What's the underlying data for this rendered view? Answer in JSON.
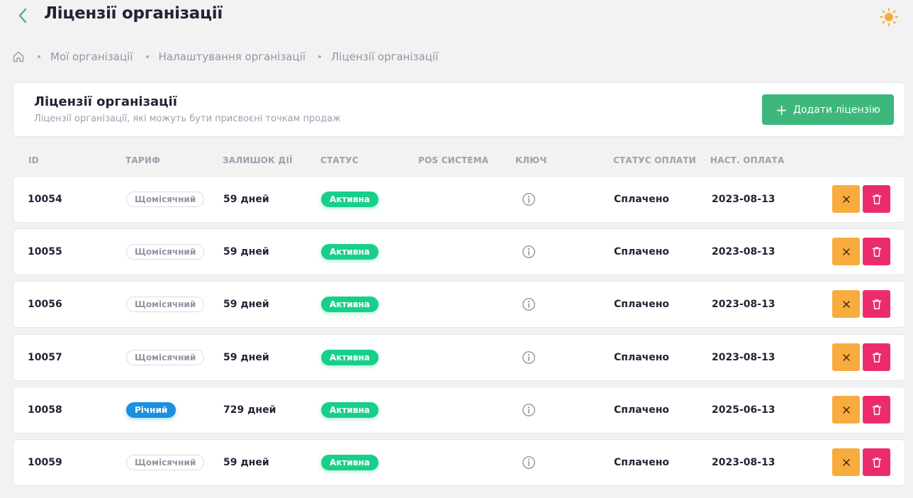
{
  "header": {
    "title": "Ліцензії організації"
  },
  "breadcrumb": {
    "items": [
      "Мої організації",
      "Налаштування організації",
      "Ліцензії організації"
    ]
  },
  "card": {
    "title": "Ліцензії організації",
    "subtitle": "Ліцензії організації, які можуть бути присвоєні точкам продаж",
    "add_button_label": "Додати ліцензію"
  },
  "table": {
    "columns": [
      "ID",
      "ТАРИФ",
      "ЗАЛИШОК ДІЇ",
      "СТАТУС",
      "POS СИСТЕМА",
      "КЛЮЧ",
      "СТАТУС ОПЛАТИ",
      "НАСТ. ОПЛАТА"
    ],
    "rows": [
      {
        "id": "10054",
        "tariff": "Щомісячний",
        "tariff_type": "monthly",
        "remaining": "59 дней",
        "status": "Активна",
        "pos": "",
        "payment_status": "Сплачено",
        "next_payment": "2023-08-13"
      },
      {
        "id": "10055",
        "tariff": "Щомісячний",
        "tariff_type": "monthly",
        "remaining": "59 дней",
        "status": "Активна",
        "pos": "",
        "payment_status": "Сплачено",
        "next_payment": "2023-08-13"
      },
      {
        "id": "10056",
        "tariff": "Щомісячний",
        "tariff_type": "monthly",
        "remaining": "59 дней",
        "status": "Активна",
        "pos": "",
        "payment_status": "Сплачено",
        "next_payment": "2023-08-13"
      },
      {
        "id": "10057",
        "tariff": "Щомісячний",
        "tariff_type": "monthly",
        "remaining": "59 дней",
        "status": "Активна",
        "pos": "",
        "payment_status": "Сплачено",
        "next_payment": "2023-08-13"
      },
      {
        "id": "10058",
        "tariff": "Річний",
        "tariff_type": "yearly",
        "remaining": "729 дней",
        "status": "Активна",
        "pos": "",
        "payment_status": "Сплачено",
        "next_payment": "2025-06-13"
      },
      {
        "id": "10059",
        "tariff": "Щомісячний",
        "tariff_type": "monthly",
        "remaining": "59 дней",
        "status": "Активна",
        "pos": "",
        "payment_status": "Сплачено",
        "next_payment": "2023-08-13"
      }
    ]
  },
  "icons": {
    "back": "chevron-left-icon",
    "theme": "sun-icon",
    "home": "home-icon",
    "key_info": "info-icon",
    "cancel": "close-icon",
    "delete": "trash-icon"
  },
  "colors": {
    "primary_green": "#3db77b",
    "active_badge": "#18cf8a",
    "yearly_badge": "#1b8fe0",
    "cancel_button": "#f8ac3d",
    "delete_button": "#ec2c6a",
    "sun": "#f8ac3d"
  }
}
